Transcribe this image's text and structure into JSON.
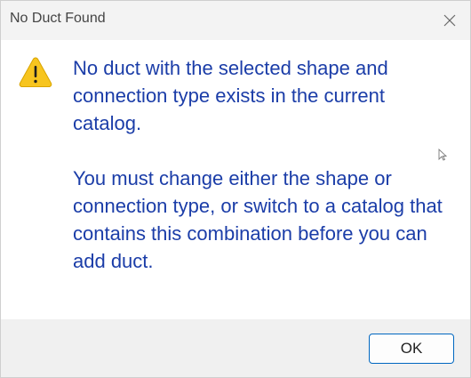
{
  "window": {
    "title": "No Duct Found",
    "close_icon": "close-icon"
  },
  "message": {
    "icon": "warning-icon",
    "paragraph_1": "No duct with the selected shape and connection type exists in the current catalog.",
    "paragraph_2": "You must change either the shape or connection type, or switch to a catalog that contains this combination before you can add duct."
  },
  "footer": {
    "ok_label": "OK"
  },
  "colors": {
    "message_text": "#1b3da8",
    "titlebar_bg": "#f3f3f3",
    "footer_bg": "#f0f0f0",
    "button_border": "#0067c0",
    "warning_fill": "#f7c51f"
  }
}
